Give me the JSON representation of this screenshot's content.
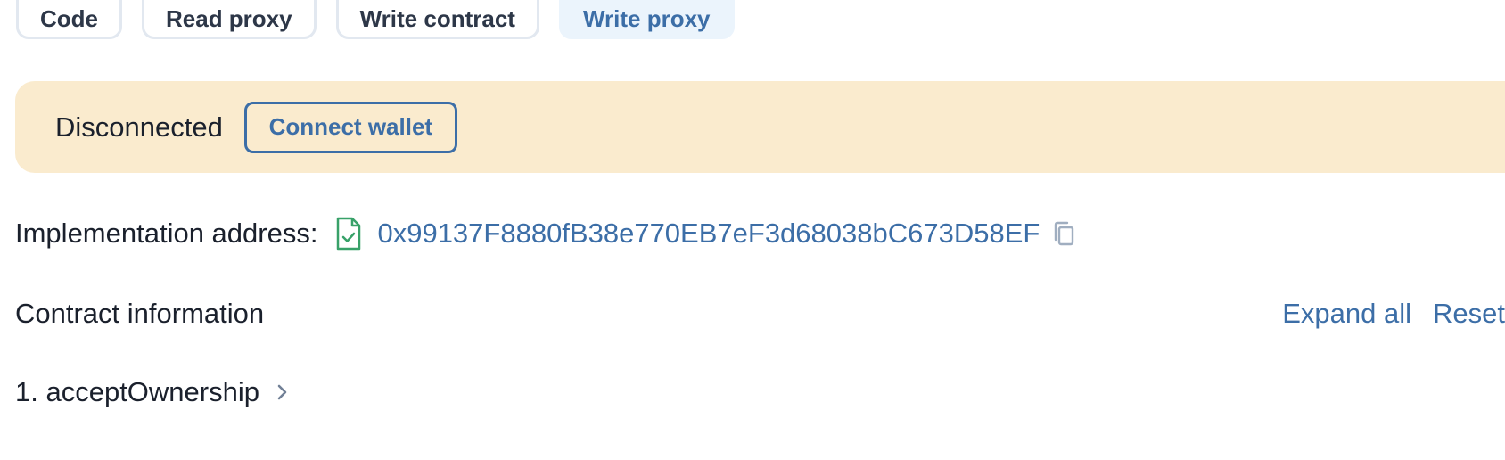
{
  "tabs": [
    {
      "label": "Code",
      "active": false
    },
    {
      "label": "Read proxy",
      "active": false
    },
    {
      "label": "Write contract",
      "active": false
    },
    {
      "label": "Write proxy",
      "active": true
    }
  ],
  "banner": {
    "status": "Disconnected",
    "connect_label": "Connect wallet"
  },
  "implementation": {
    "label": "Implementation address:",
    "address": "0x99137F8880fB38e770EB7eF3d68038bC673D58EF",
    "verified_icon": "verified-file-icon",
    "copy_icon": "copy-icon"
  },
  "contract_info": {
    "title": "Contract information",
    "expand_all": "Expand all",
    "reset": "Reset"
  },
  "methods": [
    {
      "label": "1. acceptOwnership"
    }
  ],
  "colors": {
    "accent": "#3c6ea7",
    "banner_bg": "#faebce",
    "active_tab_bg": "#ebf4fc",
    "verified_green": "#38a169"
  }
}
